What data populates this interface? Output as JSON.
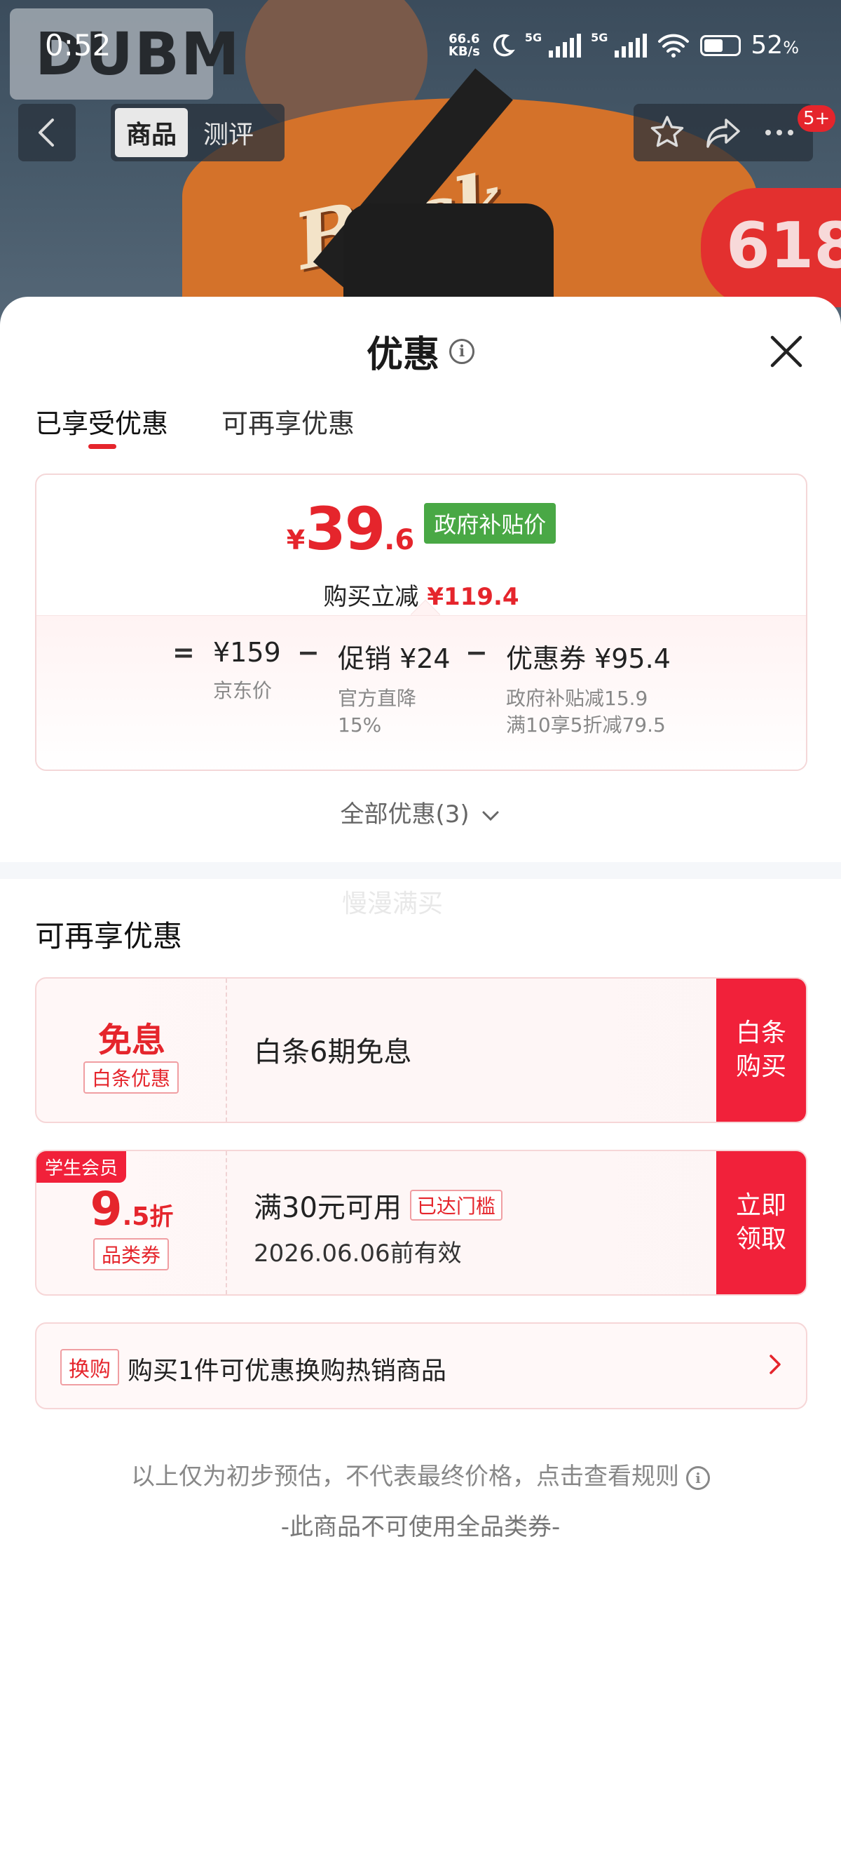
{
  "status_bar": {
    "time": "0:52",
    "net_speed_top": "66.6",
    "net_speed_bottom": "KB/s",
    "sig1": "5G",
    "sig2": "5G",
    "battery": "52",
    "battery_unit": "%"
  },
  "hero": {
    "brand": "DUBM",
    "print": "Back",
    "promo": "618"
  },
  "nav": {
    "tab_product": "商品",
    "tab_review": "测评",
    "badge": "5+"
  },
  "sheet": {
    "title": "优惠",
    "tabs": [
      "已享受优惠",
      "可再享优惠"
    ],
    "enjoyed": {
      "currency": "¥",
      "price_int": "39",
      "price_dec": ".6",
      "price_badge": "政府补贴价",
      "cut_label": "购买立减",
      "cut_value": "¥119.4",
      "eq": "=",
      "minus": "−",
      "base_amount": "¥159",
      "base_label": "京东价",
      "promo_amount": "促销 ¥24",
      "promo_label1": "官方直降",
      "promo_label2": "15%",
      "coupon_amount": "优惠券 ¥95.4",
      "coupon_label1": "政府补贴减15.9",
      "coupon_label2": "满10享5折减79.5"
    },
    "all_deals": "全部优惠(3)",
    "watermark": "慢漫满买",
    "section_title": "可再享优惠",
    "offer1": {
      "big": "免息",
      "tag": "白条优惠",
      "desc": "白条6期免息",
      "cta": "白条\n购买"
    },
    "offer2": {
      "student": "学生会员",
      "big_int": "9",
      "big_dec": ".5",
      "big_unit": "折",
      "tag": "品类券",
      "desc": "满30元可用",
      "reached": "已达门槛",
      "expire": "2026.06.06前有效",
      "cta": "立即\n领取"
    },
    "swap": {
      "tag": "换购",
      "text": "购买1件可优惠换购热销商品"
    },
    "disclaimer": "以上仅为初步预估，不代表最终价格，点击查看规则",
    "no_coupon": "-此商品不可使用全品类券-"
  },
  "colors": {
    "accent": "#e5252c",
    "cta": "#f1213a",
    "gov_badge": "#49a845"
  }
}
